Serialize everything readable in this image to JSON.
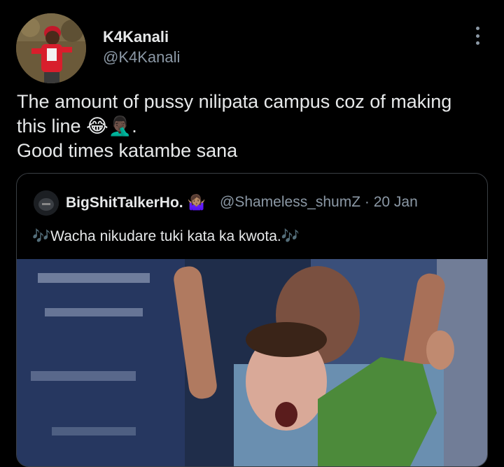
{
  "author": {
    "display_name": "K4Kanali",
    "handle": "@K4Kanali",
    "avatar_icon": "user-avatar"
  },
  "tweet": {
    "line1": "The amount of pussy nilipata campus coz of making",
    "line2_text": "this line ",
    "line2_emoji": "😂🤦🏿‍♂️",
    "line2_end": ".",
    "line3": "Good times katambe sana"
  },
  "quoted": {
    "display_name": "BigShitTalkerHo.",
    "name_emoji": "🤷🏽‍♀️",
    "handle_time": "@Shameless_shumZ · 20 Jan",
    "note_left": "🎶",
    "text": "Wacha nikudare tuki kata ka kwota.",
    "note_right": "🎶"
  },
  "menu": {
    "icon": "more-vertical-icon"
  }
}
